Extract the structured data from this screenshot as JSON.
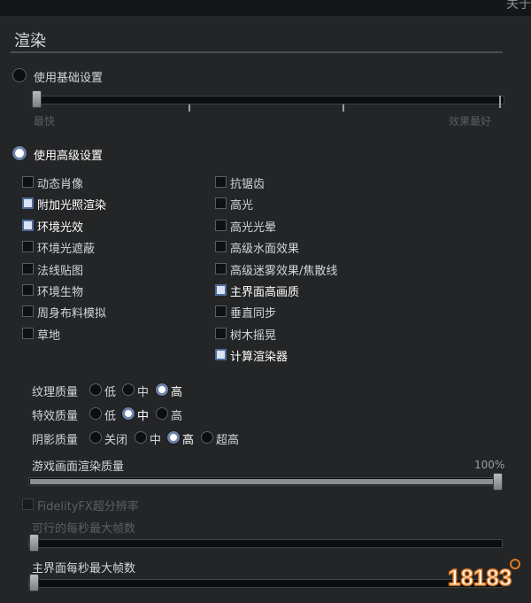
{
  "header": {
    "about_label": "关于"
  },
  "section": {
    "title": "渲染"
  },
  "basic": {
    "label": "使用基础设置",
    "left_label": "最快",
    "right_label": "效果最好",
    "level": 0
  },
  "advanced": {
    "label": "使用高级设置"
  },
  "options_left": [
    {
      "label": "动态肖像",
      "checked": false
    },
    {
      "label": "附加光照渲染",
      "checked": true
    },
    {
      "label": "环境光效",
      "checked": true
    },
    {
      "label": "环境光遮蔽",
      "checked": false
    },
    {
      "label": "法线贴图",
      "checked": false
    },
    {
      "label": "环境生物",
      "checked": false
    },
    {
      "label": "周身布料模拟",
      "checked": false
    },
    {
      "label": "草地",
      "checked": false
    }
  ],
  "options_right": [
    {
      "label": "抗锯齿",
      "checked": false
    },
    {
      "label": "高光",
      "checked": false
    },
    {
      "label": "高光光晕",
      "checked": false
    },
    {
      "label": "高级水面效果",
      "checked": false
    },
    {
      "label": "高级迷雾效果/焦散线",
      "checked": false
    },
    {
      "label": "主界面高画质",
      "checked": true
    },
    {
      "label": "垂直同步",
      "checked": false
    },
    {
      "label": "树木摇晃",
      "checked": false
    },
    {
      "label": "计算渲染器",
      "checked": true
    }
  ],
  "quality": {
    "texture": {
      "label": "纹理质量",
      "options": [
        "低",
        "中",
        "高"
      ],
      "selected": 2
    },
    "effects": {
      "label": "特效质量",
      "options": [
        "低",
        "中",
        "高"
      ],
      "selected": 1
    },
    "shadow": {
      "label": "阴影质量",
      "options": [
        "关闭",
        "中",
        "高",
        "超高"
      ],
      "selected": 2
    }
  },
  "render_quality": {
    "label": "游戏画面渲染质量",
    "value_text": "100%",
    "value": 1.0
  },
  "fidelity": {
    "label": "FidelityFX超分辨率",
    "checked": false
  },
  "max_fps": {
    "label": "可行的每秒最大帧数",
    "value": 0
  },
  "menu_fps": {
    "label": "主界面每秒最大帧数",
    "value": 0
  },
  "watermark": {
    "text": "18183"
  },
  "colors": {
    "accent": "#6e7fa8",
    "background": "#232527"
  }
}
